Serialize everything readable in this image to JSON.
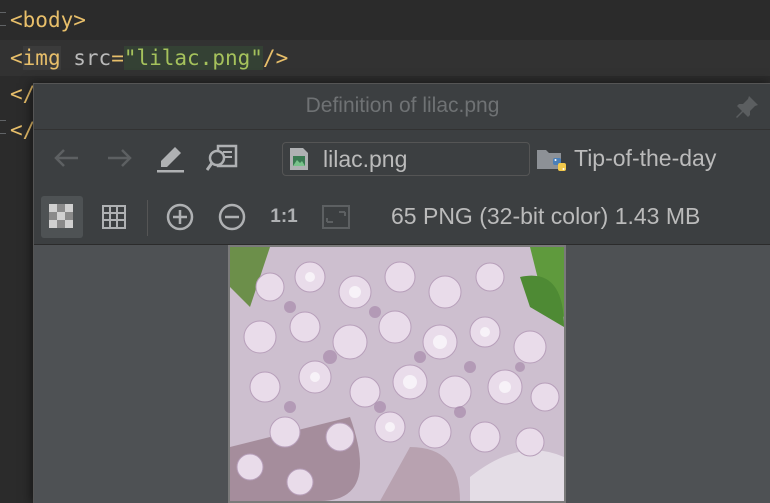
{
  "editor": {
    "lines": [
      {
        "open": "<",
        "tag": "body",
        "close": ">"
      },
      {
        "open": "<",
        "tag": "img",
        "attr": "src",
        "eq": "=",
        "value": "\"lilac.png\"",
        "close": "/>"
      },
      {
        "partial": "</"
      },
      {
        "partial": "</"
      }
    ]
  },
  "popup": {
    "title": "Definition of lilac.png",
    "pin_icon": "pin-icon",
    "nav": {
      "back_icon": "arrow-left-icon",
      "forward_icon": "arrow-right-icon",
      "edit_icon": "pencil-icon",
      "find_usages_icon": "find-usages-icon",
      "file_name": "lilac.png",
      "file_icon": "image-file-icon",
      "module_name": "Tip-of-the-day",
      "module_icon": "python-folder-icon"
    },
    "image_toolbar": {
      "buttons": [
        {
          "icon": "chessboard-icon",
          "active": true
        },
        {
          "icon": "grid-icon",
          "active": false
        },
        {
          "icon": "zoom-in-icon",
          "active": false
        },
        {
          "icon": "zoom-out-icon",
          "active": false
        },
        {
          "icon": "actual-size-icon",
          "label": "1:1",
          "active": false
        },
        {
          "icon": "fit-zoom-icon",
          "active": false
        }
      ],
      "image_info": "65 PNG (32-bit color) 1.43 MB"
    },
    "image_alt": "Lilac flowers photo"
  }
}
